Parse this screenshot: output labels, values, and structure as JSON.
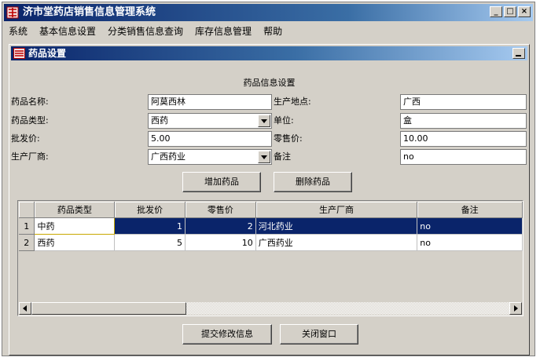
{
  "window": {
    "title": "济市堂药店销售信息管理系统",
    "controls": [
      "_",
      "□",
      "×"
    ]
  },
  "menu": [
    "系统",
    "基本信息设置",
    "分类销售信息查询",
    "库存信息管理",
    "帮助"
  ],
  "dialog": {
    "title": "药品设置",
    "section_title": "药品信息设置",
    "form": {
      "name_label": "药品名称:",
      "name_value": "阿莫西林",
      "origin_label": "生产地点:",
      "origin_value": "广西",
      "type_label": "药品类型:",
      "type_value": "西药",
      "unit_label": "单位:",
      "unit_value": "盒",
      "wholesale_label": "批发价:",
      "wholesale_value": "5.00",
      "retail_label": "零售价:",
      "retail_value": "10.00",
      "maker_label": "生产厂商:",
      "maker_value": "广西药业",
      "note_label": "备注",
      "note_value": "no"
    },
    "buttons": {
      "add": "增加药品",
      "delete": "删除药品",
      "submit": "提交修改信息",
      "close": "关闭窗口"
    },
    "table": {
      "columns": [
        "",
        "药品类型",
        "批发价",
        "零售价",
        "生产厂商",
        "备注"
      ],
      "rows": [
        [
          "1",
          "中药",
          "1",
          "2",
          "河北药业",
          "no"
        ],
        [
          "2",
          "西药",
          "5",
          "10",
          "广西药业",
          "no"
        ]
      ]
    }
  },
  "colors": {
    "title_gradient_start": "#0a246a",
    "selection": "#0a246a",
    "face": "#d4d0c8"
  }
}
